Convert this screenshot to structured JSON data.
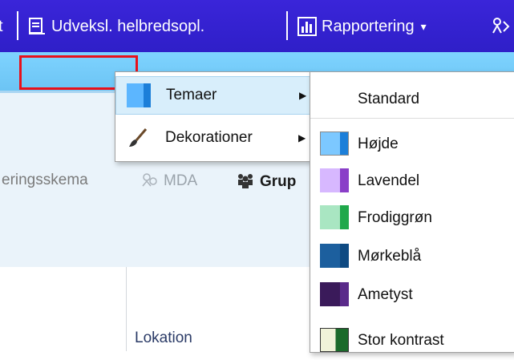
{
  "toolbar": {
    "partial_left": "t",
    "exchange_label": "Udveksl. helbredsopl.",
    "reports_label": "Rapportering",
    "reports_caret": "▾"
  },
  "background": {
    "partial_form_label": "eringsskema",
    "mda_label": "MDA",
    "group_label": "Grup",
    "location_label": "Lokation"
  },
  "menu_main": {
    "items": [
      {
        "label": "Temaer",
        "icon": "theme-icon",
        "arrow": "▶"
      },
      {
        "label": "Dekorationer",
        "icon": "paintbrush-icon",
        "arrow": "▶"
      }
    ]
  },
  "menu_themes": {
    "items": [
      {
        "label": "Standard",
        "icon": "none",
        "color": ""
      },
      {
        "label": "Højde",
        "icon": "swatch-icon",
        "color": "#2f9be8"
      },
      {
        "label": "Lavendel",
        "icon": "swatch-icon",
        "color": "#8a3fc8"
      },
      {
        "label": "Frodiggrøn",
        "icon": "swatch-icon",
        "color": "#1fa84a"
      },
      {
        "label": "Mørkeblå",
        "icon": "swatch-icon",
        "color": "#0f5a9c"
      },
      {
        "label": "Ametyst",
        "icon": "swatch-icon",
        "color": "#5a2a8a"
      },
      {
        "label": "Stor kontrast",
        "icon": "swatch-icon",
        "color": "#1a6a2a"
      }
    ]
  },
  "colors": {
    "toolbar_bg": "#3a25d9",
    "band_bg": "#7ed3ff",
    "highlight": "#e8101a"
  }
}
